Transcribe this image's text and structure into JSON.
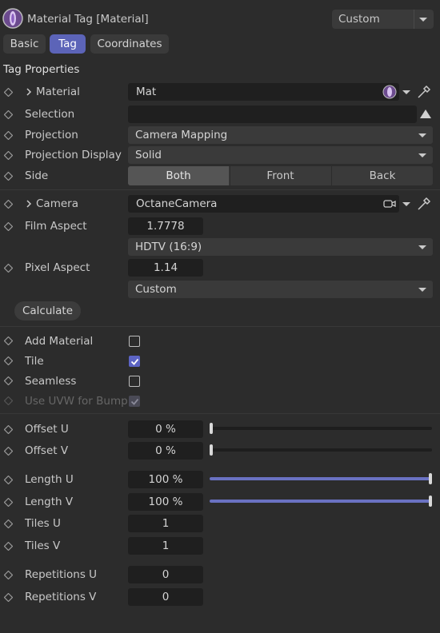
{
  "header": {
    "title": "Material Tag [Material]",
    "mode_dropdown": "Custom"
  },
  "tabs": [
    {
      "label": "Basic",
      "active": false
    },
    {
      "label": "Tag",
      "active": true
    },
    {
      "label": "Coordinates",
      "active": false
    }
  ],
  "section_title": "Tag Properties",
  "material": {
    "label": "Material",
    "value": "Mat"
  },
  "selection": {
    "label": "Selection",
    "value": ""
  },
  "projection": {
    "label": "Projection",
    "value": "Camera Mapping"
  },
  "projection_display": {
    "label": "Projection Display",
    "value": "Solid"
  },
  "side": {
    "label": "Side",
    "options": [
      "Both",
      "Front",
      "Back"
    ],
    "selected": "Both"
  },
  "camera": {
    "label": "Camera",
    "value": "OctaneCamera"
  },
  "film_aspect": {
    "label": "Film Aspect",
    "value": "1.7778",
    "preset": "HDTV (16:9)"
  },
  "pixel_aspect": {
    "label": "Pixel Aspect",
    "value": "1.14",
    "preset": "Custom"
  },
  "calculate_button": "Calculate",
  "add_material": {
    "label": "Add Material",
    "checked": false
  },
  "tile": {
    "label": "Tile",
    "checked": true
  },
  "seamless": {
    "label": "Seamless",
    "checked": false
  },
  "use_uvw_bump": {
    "label": "Use UVW for Bump",
    "checked": true,
    "enabled": false
  },
  "offset_u": {
    "label": "Offset U",
    "value": "0 %",
    "level": 0
  },
  "offset_v": {
    "label": "Offset V",
    "value": "0 %",
    "level": 0
  },
  "length_u": {
    "label": "Length U",
    "value": "100 %",
    "level": 1
  },
  "length_v": {
    "label": "Length V",
    "value": "100 %",
    "level": 1
  },
  "tiles_u": {
    "label": "Tiles U",
    "value": "1"
  },
  "tiles_v": {
    "label": "Tiles V",
    "value": "1"
  },
  "repetitions_u": {
    "label": "Repetitions U",
    "value": "0"
  },
  "repetitions_v": {
    "label": "Repetitions V",
    "value": "0"
  },
  "colors": {
    "accent": "#5c64b8",
    "slider_fill": "#6a72c2",
    "background": "#2c2c2c"
  }
}
